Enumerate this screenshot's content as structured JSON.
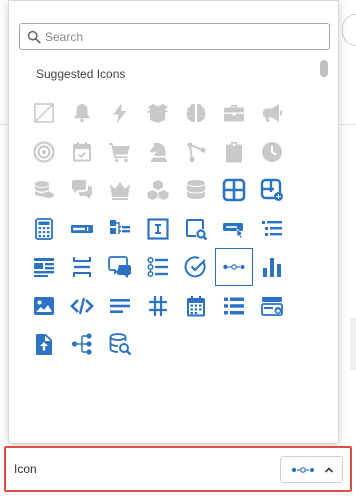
{
  "search": {
    "placeholder": "Search",
    "value": ""
  },
  "suggested": {
    "title": "Suggested Icons",
    "icons": [
      {
        "name": "empty-icon",
        "active": false
      },
      {
        "name": "bell-icon",
        "active": false
      },
      {
        "name": "lightning-icon",
        "active": false
      },
      {
        "name": "box-open-icon",
        "active": false
      },
      {
        "name": "brain-icon",
        "active": false
      },
      {
        "name": "briefcase-icon",
        "active": false
      },
      {
        "name": "megaphone-icon",
        "active": false
      },
      {
        "name": "target-icon",
        "active": false
      },
      {
        "name": "calendar-check-icon",
        "active": false
      },
      {
        "name": "cart-icon",
        "active": false
      },
      {
        "name": "chess-knight-icon",
        "active": false
      },
      {
        "name": "nodes-icon",
        "active": false
      },
      {
        "name": "clipboard-icon",
        "active": false
      },
      {
        "name": "clock-icon",
        "active": false
      },
      {
        "name": "coins-icon",
        "active": false
      },
      {
        "name": "comments-icon",
        "active": false
      },
      {
        "name": "crown-icon",
        "active": false
      },
      {
        "name": "cubes-icon",
        "active": false
      },
      {
        "name": "database-icon",
        "active": false
      },
      {
        "name": "layout-grid-icon",
        "active": true
      },
      {
        "name": "layout-add-icon",
        "active": true
      },
      {
        "name": "calculator-icon",
        "active": true
      },
      {
        "name": "text-input-icon",
        "active": true
      },
      {
        "name": "flow-list-icon",
        "active": true
      },
      {
        "name": "text-cursor-box-icon",
        "active": true
      },
      {
        "name": "frame-search-icon",
        "active": true
      },
      {
        "name": "button-click-icon",
        "active": true
      },
      {
        "name": "indented-list-icon",
        "active": true
      },
      {
        "name": "news-icon",
        "active": true
      },
      {
        "name": "spacing-icon",
        "active": true
      },
      {
        "name": "chat-window-icon",
        "active": true
      },
      {
        "name": "numbered-list-icon",
        "active": true
      },
      {
        "name": "check-circle-icon",
        "active": true
      },
      {
        "name": "stepper-icon",
        "active": true,
        "selected": true
      },
      {
        "name": "bar-chart-icon",
        "active": true
      },
      {
        "name": "image-icon",
        "active": true
      },
      {
        "name": "code-icon",
        "active": true
      },
      {
        "name": "align-left-icon",
        "active": true
      },
      {
        "name": "hashtag-icon",
        "active": true
      },
      {
        "name": "calendar-grid-icon",
        "active": true
      },
      {
        "name": "list-icon",
        "active": true
      },
      {
        "name": "card-stack-icon",
        "active": true
      },
      {
        "name": "file-upload-icon",
        "active": true
      },
      {
        "name": "sitemap-icon",
        "active": true
      },
      {
        "name": "database-search-icon",
        "active": true
      }
    ]
  },
  "field": {
    "label": "Icon",
    "selected_icon": "stepper-icon"
  },
  "colors": {
    "icon_active": "#2d73c3",
    "icon_inactive": "#c9c9c9",
    "highlight_border": "#e14f42"
  }
}
